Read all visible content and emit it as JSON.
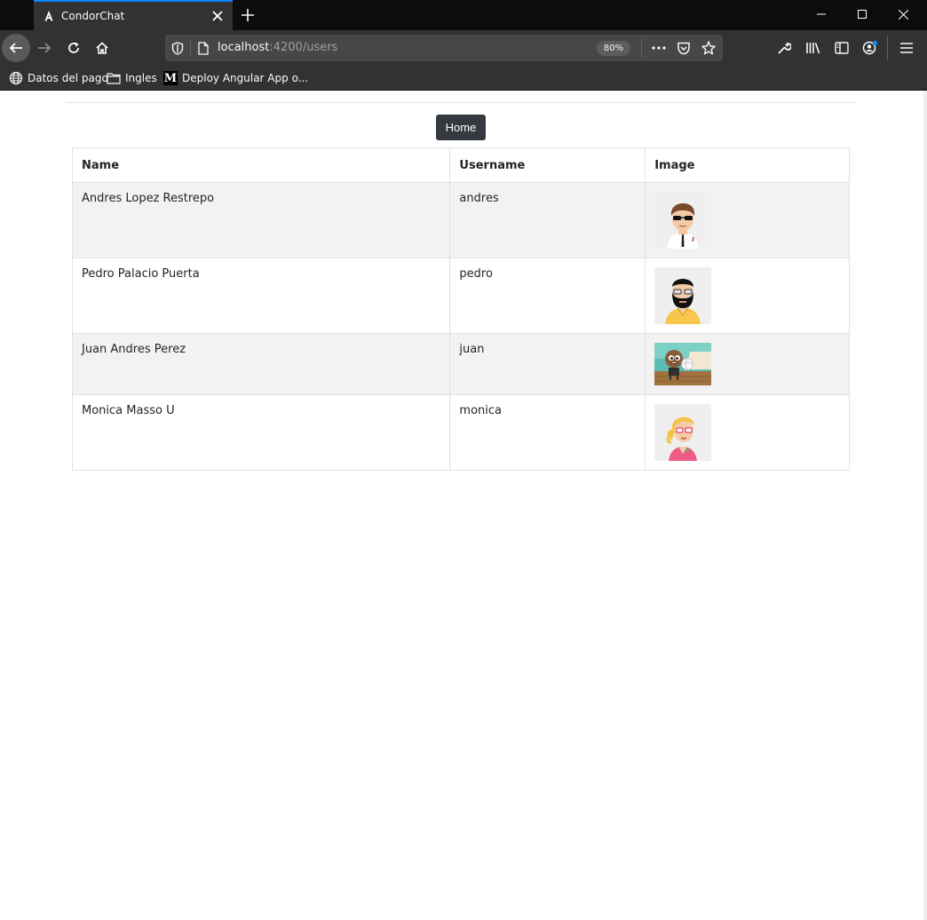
{
  "browser": {
    "tab_title": "CondorChat",
    "url_host": "localhost",
    "url_path": ":4200/users",
    "zoom": "80%",
    "bookmarks": [
      {
        "label": "Datos del pago",
        "icon": "globe-icon"
      },
      {
        "label": "Ingles",
        "icon": "folder-icon"
      },
      {
        "label": "Deploy Angular App o...",
        "icon": "medium-icon"
      }
    ],
    "accent_color": "#0a84ff"
  },
  "page": {
    "home_button": "Home",
    "table": {
      "headers": [
        "Name",
        "Username",
        "Image"
      ],
      "rows": [
        {
          "name": "Andres Lopez Restrepo",
          "username": "andres",
          "avatar": "avatar-sunglasses-man"
        },
        {
          "name": "Pedro Palacio Puerta",
          "username": "pedro",
          "avatar": "avatar-bearded-man"
        },
        {
          "name": "Juan Andres Perez",
          "username": "juan",
          "avatar": "avatar-boy-volleyball"
        },
        {
          "name": "Monica Masso U",
          "username": "monica",
          "avatar": "avatar-blonde-woman"
        }
      ]
    }
  }
}
